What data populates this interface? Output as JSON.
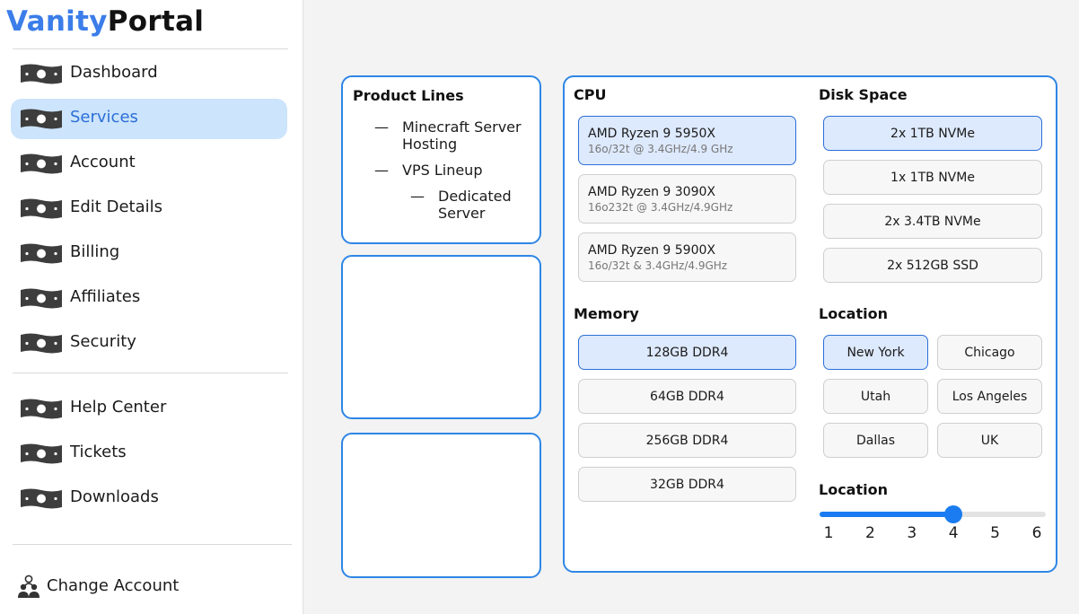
{
  "brand": {
    "part1": "Vanity",
    "part2": "Portal",
    "accent": "#3b7de9"
  },
  "sidebar": {
    "items": [
      {
        "label": "Dashboard",
        "icon": "cash-bill-icon",
        "active": false
      },
      {
        "label": "Services",
        "icon": "cash-bill-icon",
        "active": true
      },
      {
        "label": "Account",
        "icon": "cash-bill-icon",
        "active": false
      },
      {
        "label": "Edit Details",
        "icon": "cash-bill-icon",
        "active": false
      },
      {
        "label": "Billing",
        "icon": "cash-bill-icon",
        "active": false
      },
      {
        "label": "Affiliates",
        "icon": "cash-bill-icon",
        "active": false
      },
      {
        "label": "Security",
        "icon": "cash-bill-icon",
        "active": false
      }
    ],
    "support_items": [
      {
        "label": "Help Center",
        "icon": "cash-bill-icon"
      },
      {
        "label": "Tickets",
        "icon": "cash-bill-icon"
      },
      {
        "label": "Downloads",
        "icon": "cash-bill-icon"
      }
    ],
    "change_account": {
      "label": "Change Account",
      "icon": "users-icon"
    }
  },
  "product_lines": {
    "title": "Product Lines",
    "items": [
      {
        "dash": "—",
        "label": "Minecraft Server Hosting"
      },
      {
        "dash": "—",
        "label": "VPS Lineup"
      },
      {
        "dash": "—",
        "label": "Dedicated Server"
      }
    ]
  },
  "config": {
    "cpu": {
      "title": "CPU",
      "options": [
        {
          "name": "AMD Ryzen 9 5950X",
          "detail": "16o/32t @ 3.4GHz/4.9 GHz",
          "selected": true
        },
        {
          "name": "AMD Ryzen 9 3090X",
          "detail": "16o232t @ 3.4GHz/4.9GHz",
          "selected": false
        },
        {
          "name": "AMD Ryzen 9 5900X",
          "detail": "16o/32t & 3.4GHz/4.9GHz",
          "selected": false
        }
      ]
    },
    "disk": {
      "title": "Disk Space",
      "options": [
        {
          "label": "2x 1TB NVMe",
          "selected": true
        },
        {
          "label": "1x 1TB NVMe",
          "selected": false
        },
        {
          "label": "2x 3.4TB NVMe",
          "selected": false
        },
        {
          "label": "2x 512GB SSD",
          "selected": false
        }
      ]
    },
    "memory": {
      "title": "Memory",
      "options": [
        {
          "label": "128GB DDR4",
          "selected": true
        },
        {
          "label": "64GB DDR4",
          "selected": false
        },
        {
          "label": "256GB DDR4",
          "selected": false
        },
        {
          "label": "32GB DDR4",
          "selected": false
        }
      ]
    },
    "location": {
      "title": "Location",
      "options": [
        {
          "label": "New York",
          "selected": true
        },
        {
          "label": "Chicago",
          "selected": false
        },
        {
          "label": "Utah",
          "selected": false
        },
        {
          "label": "Los Angeles",
          "selected": false
        },
        {
          "label": "Dallas",
          "selected": false
        },
        {
          "label": "UK",
          "selected": false
        }
      ]
    },
    "slider": {
      "title": "Location",
      "ticks": [
        "1",
        "2",
        "3",
        "4",
        "5",
        "6"
      ],
      "min": 1,
      "max": 6,
      "value": 4
    }
  },
  "colors": {
    "accent": "#1a7cf0",
    "selected_bg": "#dde9fd",
    "card_border": "#2f86e6"
  }
}
